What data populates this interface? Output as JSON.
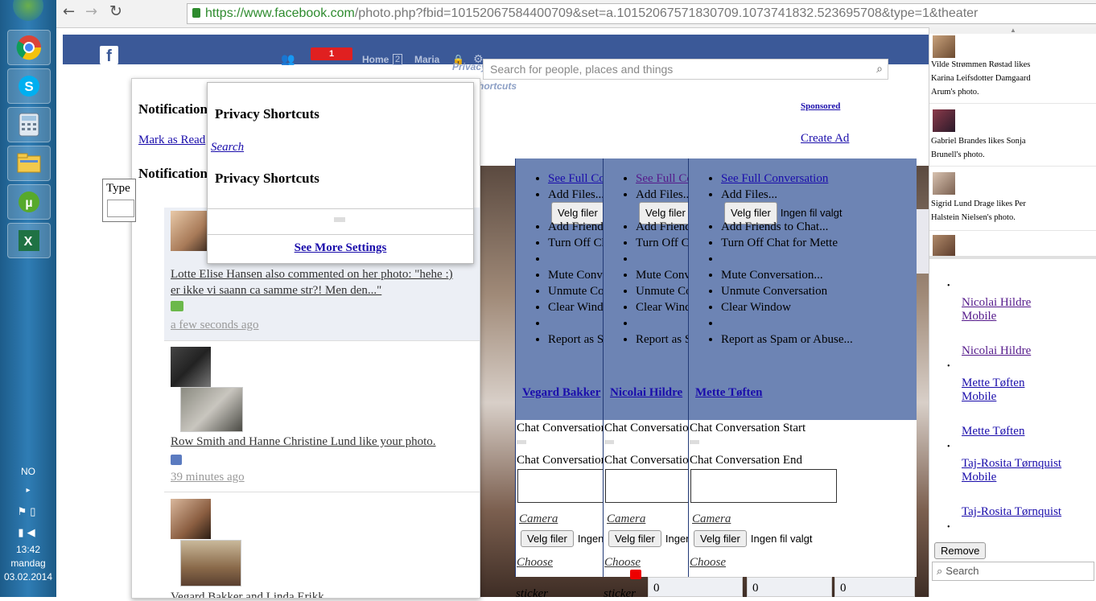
{
  "taskbar": {
    "lang": "NO",
    "time": "13:42",
    "day": "mandag",
    "date": "03.02.2014"
  },
  "browser": {
    "url_prefix": "https://www.facebook.com",
    "url_rest": "/photo.php?fbid=10152067584400709&set=a.10152067571830709.1073741832.523695708&type=1&theater"
  },
  "fb_header": {
    "notif_count": "1",
    "home_label": "Home",
    "home_count": "2",
    "user_label": "Maria",
    "privacy_label": "Privacy",
    "shortcuts_label": "Shortcuts",
    "search_placeholder": "Search for people, places and things"
  },
  "notifications": {
    "heading": "Notifications",
    "mark_read": "Mark as Read",
    "heading2": "Notifications",
    "type_label": "Type",
    "items": [
      {
        "text": "Lotte Elise Hansen also commented on her photo: \"hehe :) er ikke vi saann ca samme str?! Men den...\"",
        "time": "a few seconds ago"
      },
      {
        "text": "Row Smith and Hanne Christine Lund like your photo.",
        "time": "39 minutes ago"
      },
      {
        "text": "Vegard Bakker and Linda Erikk..."
      }
    ]
  },
  "privacy_menu": {
    "title": "Privacy Shortcuts",
    "search_link": "Search",
    "title2": "Privacy Shortcuts",
    "see_more": "See More Settings"
  },
  "ads": {
    "sponsored": "Sponsored",
    "create_ad": "Create Ad"
  },
  "chat": {
    "menu": [
      "See Full Conversation",
      "Add Files...",
      "",
      "Add Friends to Chat...",
      "Turn Off Chat for Mette",
      "",
      "Mute Conversation...",
      "Unmute Conversation",
      "Clear Window",
      "",
      "Report as Spam or Abuse..."
    ],
    "velg_filer": "Velg filer",
    "ingen_fil": "Ingen fil valgt",
    "start": "Chat Conversation Start",
    "end": "Chat Conversation End",
    "camera": "Camera",
    "choose": "Choose",
    "sticker": "sticker",
    "zero": "0",
    "windows": [
      {
        "name": "Vegard Bakker",
        "turn_off": "Turn Off Chat for Vegard"
      },
      {
        "name": "Nicolai Hildre",
        "turn_off": "Turn Off Chat for Nicolai"
      },
      {
        "name": "Mette Tøften",
        "turn_off": "Turn Off Chat for Mette"
      }
    ]
  },
  "ticker": {
    "items": [
      {
        "text": "Vilde Strømmen Røstad likes Karina Leifsdotter Damgaard Arum's photo."
      },
      {
        "text": "Gabriel Brandes likes Sonja Brunell's photo."
      },
      {
        "text": "Sigrid Lund Drage likes Per Halstein Nielsen's photo."
      }
    ]
  },
  "sidebar": {
    "contacts": [
      {
        "name": "Nicolai Hildre",
        "mobile": "Mobile",
        "name2": "Nicolai Hildre"
      },
      {
        "name": "Mette Tøften",
        "mobile": "Mobile",
        "name2": "Mette Tøften"
      },
      {
        "name": "Taj-Rosita Tørnquist",
        "mobile": "Mobile",
        "name2": "Taj-Rosita Tørnquist"
      }
    ],
    "remove": "Remove",
    "search": "Search"
  },
  "colors": {
    "fb_blue": "#3b5998",
    "chat_blue": "#6d84b4",
    "notif_red": "#e02020"
  }
}
